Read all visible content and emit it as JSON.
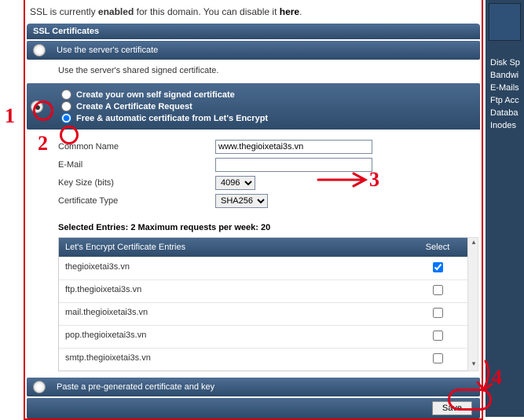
{
  "status": {
    "pre": "SSL is currently ",
    "enabled": "enabled",
    "mid": " for this domain. You can disable it ",
    "here": "here",
    "post": "."
  },
  "section": {
    "title": "SSL Certificates"
  },
  "use_server": {
    "label": "Use the server's certificate",
    "desc": "Use the server's shared signed certificate."
  },
  "opts": {
    "opt1": "Create your own self signed certificate",
    "opt2": "Create A Certificate Request",
    "opt3": "Free & automatic certificate from Let's Encrypt"
  },
  "form": {
    "common_name_label": "Common Name",
    "common_name_value": "www.thegioixetai3s.vn",
    "email_label": "E-Mail",
    "email_value": "",
    "keysize_label": "Key Size (bits)",
    "keysize_value": "4096",
    "certtype_label": "Certificate Type",
    "certtype_value": "SHA256"
  },
  "summary": {
    "text": "Selected Entries: 2    Maximum requests per week: 20"
  },
  "entries": {
    "header_name": "Let's Encrypt Certificate Entries",
    "header_select": "Select",
    "rows": [
      {
        "name": "thegioixetai3s.vn",
        "checked": true
      },
      {
        "name": "ftp.thegioixetai3s.vn",
        "checked": false
      },
      {
        "name": "mail.thegioixetai3s.vn",
        "checked": false
      },
      {
        "name": "pop.thegioixetai3s.vn",
        "checked": false
      },
      {
        "name": "smtp.thegioixetai3s.vn",
        "checked": false
      }
    ]
  },
  "paste_row": {
    "label": "Paste a pre-generated certificate and key"
  },
  "save": {
    "label": "Save"
  },
  "sidebar": {
    "items": [
      "Disk Sp",
      "Bandwi",
      "E-Mails",
      "Ftp Acc",
      "Databa",
      "Inodes"
    ]
  },
  "anno": {
    "one": "1",
    "two": "2",
    "three": "3",
    "four": "4"
  }
}
